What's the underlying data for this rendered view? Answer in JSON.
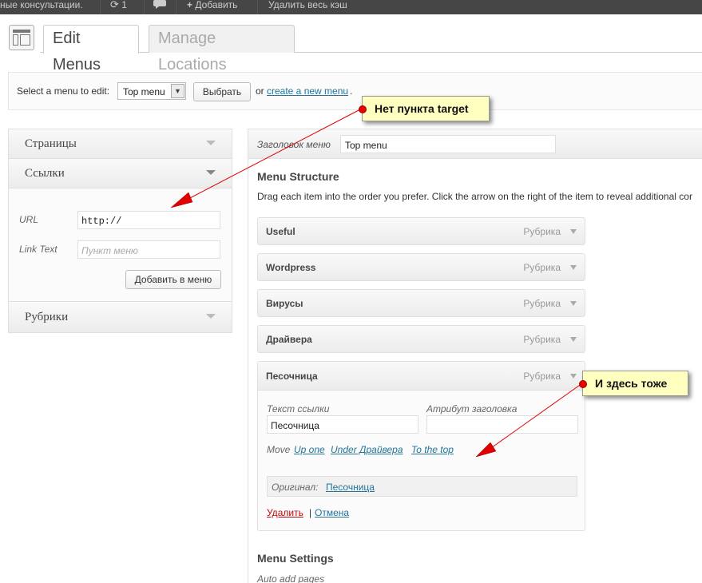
{
  "adminbar": {
    "consult_text": "ные консультации.",
    "updates_count": "1",
    "add_label": "Добавить",
    "clear_cache_label": "Удалить весь кэш"
  },
  "tabs": {
    "edit": "Edit Menus",
    "manage": "Manage Locations"
  },
  "select_bar": {
    "label": "Select a menu to edit:",
    "selected": "Top menu",
    "choose_button": "Выбрать",
    "or_text": "or",
    "create_link": "create a new menu",
    "dot": "."
  },
  "left_panel": {
    "sections": [
      {
        "title": "Страницы"
      },
      {
        "title": "Ссылки"
      },
      {
        "title": "Рубрики"
      }
    ],
    "url_label": "URL",
    "url_value": "http://",
    "link_text_label": "Link Text",
    "link_text_placeholder": "Пункт меню",
    "add_button": "Добавить в меню"
  },
  "menu": {
    "name_label": "Заголовок меню",
    "name_value": "Top menu",
    "structure_title": "Menu Structure",
    "structure_desc": "Drag each item into the order you prefer. Click the arrow on the right of the item to reveal additional cor",
    "items": [
      {
        "title": "Useful",
        "type": "Рубрика"
      },
      {
        "title": "Wordpress",
        "type": "Рубрика"
      },
      {
        "title": "Вирусы",
        "type": "Рубрика"
      },
      {
        "title": "Драйвера",
        "type": "Рубрика"
      }
    ],
    "open_item": {
      "title": "Песочница",
      "type": "Рубрика",
      "link_text_label": "Текст ссылки",
      "link_text_value": "Песочница",
      "title_attr_label": "Атрибут заголовка",
      "title_attr_value": "",
      "move_label": "Move",
      "move_up": "Up one",
      "move_under": "Under Драйвера",
      "move_top": "To the top",
      "original_label": "Оригинал:",
      "original_value": "Песочница",
      "delete": "Удалить",
      "separator": "|",
      "cancel": "Отмена"
    },
    "settings_title": "Menu Settings",
    "auto_add_label": "Auto add pages"
  },
  "annotations": {
    "callout1": "Нет пункта target",
    "callout2": "И здесь тоже",
    "callout_color": "#ffffc0",
    "arrow_color": "#e00000"
  }
}
